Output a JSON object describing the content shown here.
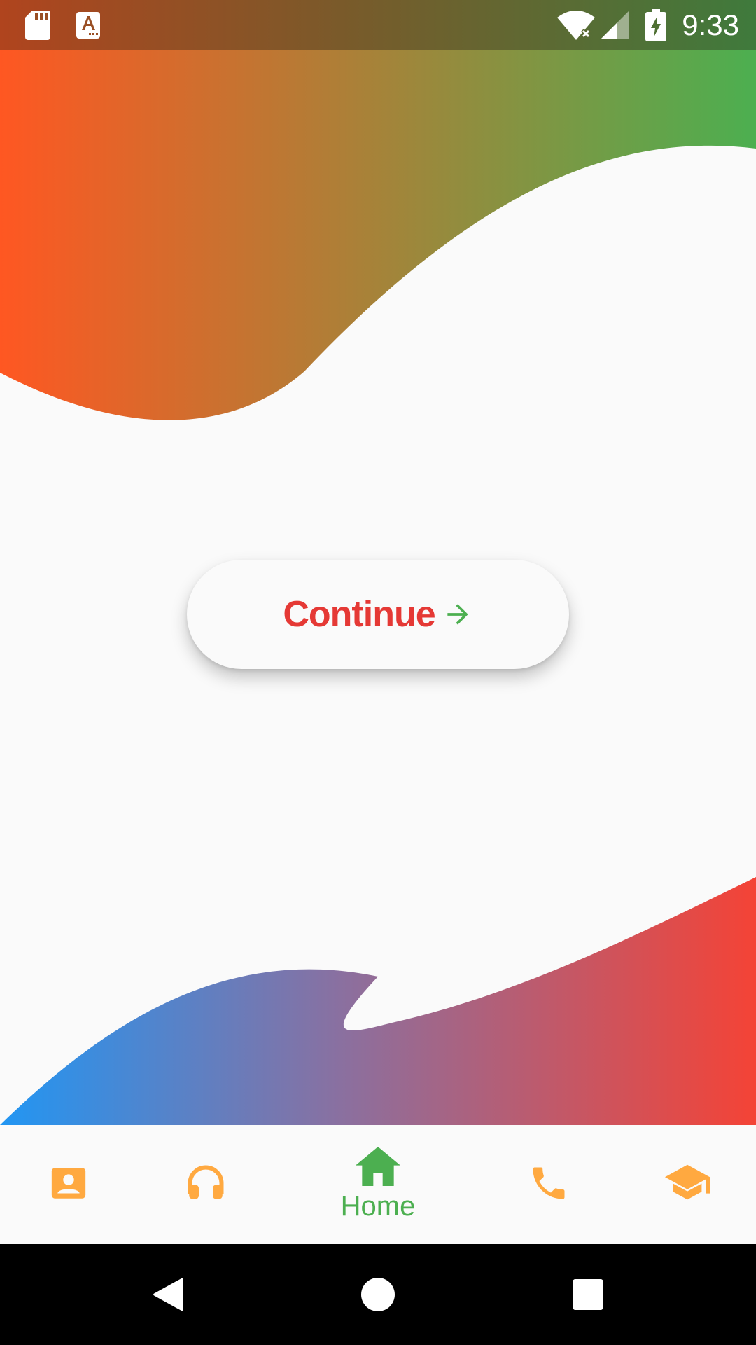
{
  "status_bar": {
    "time": "9:33",
    "icons": [
      "sd-card-icon",
      "a-notification-icon",
      "wifi-off-icon",
      "cell-signal-icon",
      "battery-charging-icon"
    ]
  },
  "main": {
    "continue_button": {
      "label": "Continue",
      "icon": "arrow-right-icon"
    }
  },
  "bottom_nav": {
    "items": [
      {
        "id": "contact",
        "icon": "contact-card-icon",
        "label": "",
        "active": false
      },
      {
        "id": "audio",
        "icon": "headphones-icon",
        "label": "",
        "active": false
      },
      {
        "id": "home",
        "icon": "home-icon",
        "label": "Home",
        "active": true
      },
      {
        "id": "phone",
        "icon": "phone-icon",
        "label": "",
        "active": false
      },
      {
        "id": "education",
        "icon": "graduation-cap-icon",
        "label": "",
        "active": false
      }
    ]
  },
  "colors": {
    "accent_active": "#4caf50",
    "nav_inactive": "#ffa940",
    "button_text": "#e53935",
    "top_wave": [
      "#ff5722",
      "#4caf50"
    ],
    "bottom_wave": [
      "#2196f3",
      "#f44336"
    ]
  },
  "system_nav": {
    "buttons": [
      "back-icon",
      "home-circle-icon",
      "recents-icon"
    ]
  }
}
